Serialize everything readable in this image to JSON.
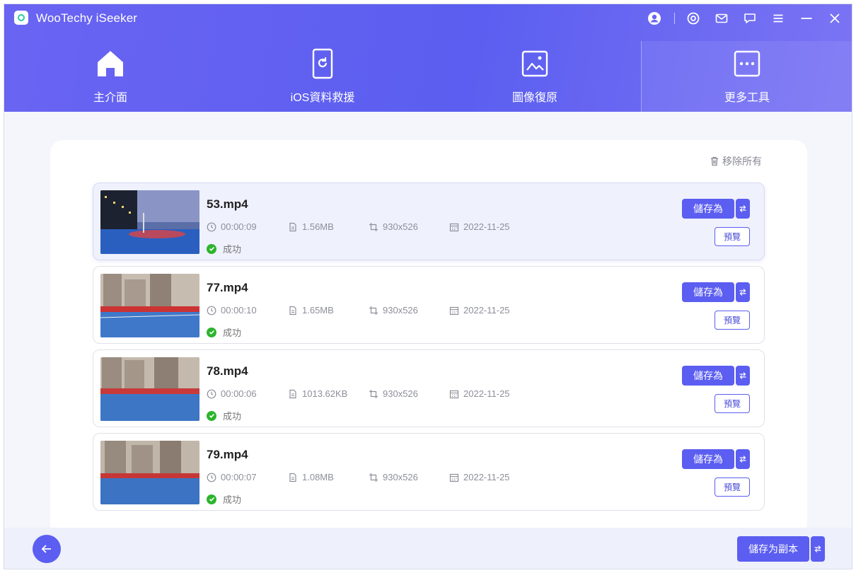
{
  "app": {
    "title": "WooTechy iSeeker"
  },
  "window_controls": [
    "account-icon",
    "settings-icon",
    "mail-icon",
    "feedback-icon",
    "menu-icon",
    "minimize-icon",
    "close-icon"
  ],
  "nav": {
    "items": [
      {
        "label": "主介面",
        "icon": "home-icon",
        "active": false
      },
      {
        "label": "iOS資料救援",
        "icon": "phone-refresh-icon",
        "active": false
      },
      {
        "label": "圖像復原",
        "icon": "image-icon",
        "active": false
      },
      {
        "label": "更多工具",
        "icon": "more-tools-icon",
        "active": true
      }
    ]
  },
  "card": {
    "remove_all": "移除所有"
  },
  "files": [
    {
      "name": "53.mp4",
      "duration": "00:00:09",
      "size": "1.56MB",
      "resolution": "930x526",
      "date": "2022-11-25",
      "status": "成功",
      "save_label": "儲存為",
      "preview_label": "預覽"
    },
    {
      "name": "77.mp4",
      "duration": "00:00:10",
      "size": "1.65MB",
      "resolution": "930x526",
      "date": "2022-11-25",
      "status": "成功",
      "save_label": "儲存為",
      "preview_label": "預覽"
    },
    {
      "name": "78.mp4",
      "duration": "00:00:06",
      "size": "1013.62KB",
      "resolution": "930x526",
      "date": "2022-11-25",
      "status": "成功",
      "save_label": "儲存為",
      "preview_label": "預覽"
    },
    {
      "name": "79.mp4",
      "duration": "00:00:07",
      "size": "1.08MB",
      "resolution": "930x526",
      "date": "2022-11-25",
      "status": "成功",
      "save_label": "儲存為",
      "preview_label": "預覽"
    }
  ],
  "footer": {
    "save_copy_label": "儲存为副本"
  },
  "colors": {
    "accent": "#5b5ef0",
    "success": "#2cb52c",
    "header_start": "#6a64f2",
    "header_end": "#7b74f4"
  }
}
